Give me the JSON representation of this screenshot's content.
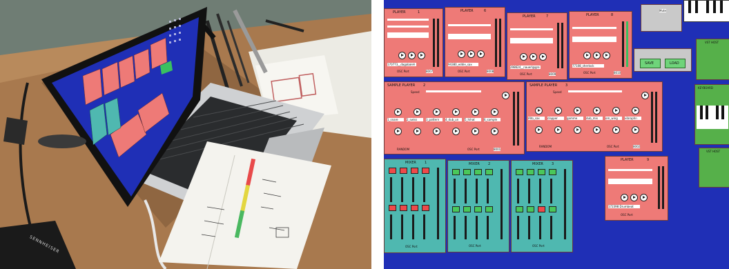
{
  "photo_left": {
    "headphones_brand": "SENNHEISER"
  },
  "photo_right": {
    "players": [
      {
        "title": "PLAYER",
        "num": "1",
        "file": "170773__dagabaleh",
        "port_label": "OSC Port",
        "port": "8007"
      },
      {
        "title": "PLAYER",
        "num": "6",
        "file": "94380_eddie_sax",
        "port_label": "OSC Port",
        "port": "8008"
      },
      {
        "title": "PLAYER",
        "num": "7",
        "file": "298624__nauerl@gre",
        "port_label": "OSC Port",
        "port": "8009"
      },
      {
        "title": "PLAYER",
        "num": "8",
        "file": "77108_sherlock",
        "port_label": "OSC Port",
        "port": "8010"
      },
      {
        "title": "PLAYER",
        "num": "9",
        "file": "172398 Drumbeat",
        "port_label": "OSC Port",
        "port": ""
      }
    ],
    "samples": [
      {
        "title": "SAMPLE PLAYER",
        "num": "2",
        "speed": "Speed",
        "random": "RANDOM",
        "port_label": "OSC Port",
        "port": "8001",
        "slots": [
          "1_snare",
          "2_swiss",
          "3_pattern",
          "4_dub_un",
          "5_hihat",
          "6_sample"
        ]
      },
      {
        "title": "SAMPLE PLAYER",
        "num": "3",
        "speed": "Speed",
        "random": "RANDOM",
        "port_label": "OSC Port",
        "port": "8002",
        "slots": [
          "Alto_sax",
          "clapper",
          "gamme",
          "dub_mix",
          "om_wing",
          "vibraphn"
        ]
      }
    ],
    "mixers": [
      {
        "title": "MIXER",
        "num": "1",
        "port_label": "OSC Port"
      },
      {
        "title": "MIXER",
        "num": "2",
        "port_label": "OSC Port"
      },
      {
        "title": "MIXER",
        "num": "3",
        "port_label": "OSC Port"
      }
    ],
    "misc": {
      "save": "SAVE",
      "load": "LOAD",
      "vst_host": "VST HOST",
      "keyboard": "KEYBOARD",
      "mute": "Mute"
    },
    "colors": {
      "desktop": "#1f2fb6",
      "player": "#ee7a77",
      "mixer": "#4fb8b0"
    }
  }
}
